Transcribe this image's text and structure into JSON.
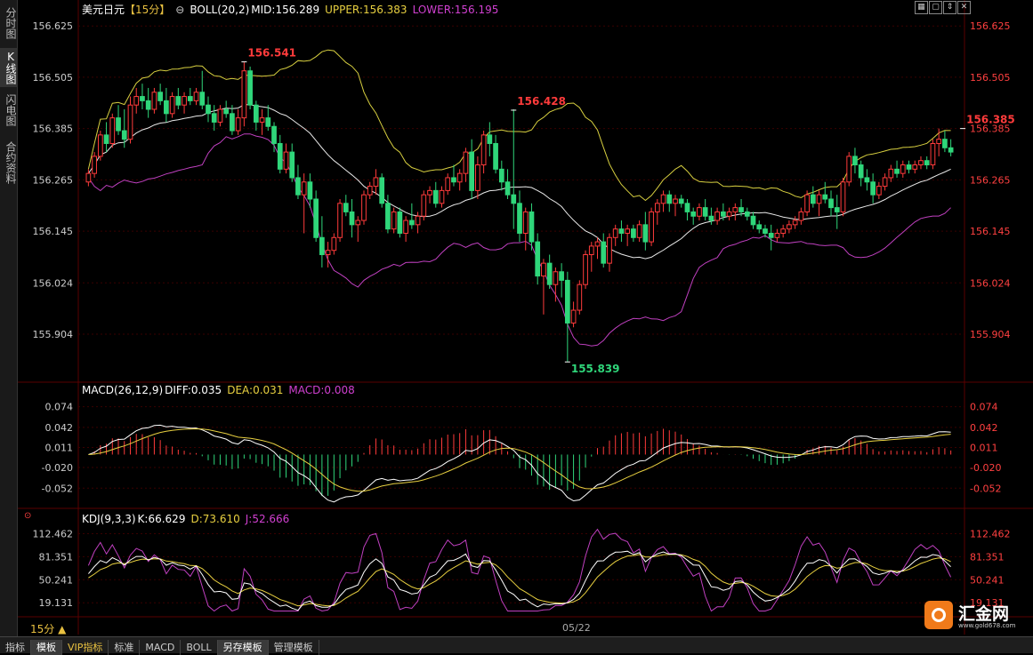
{
  "sidebar": {
    "tabs": [
      "分时图",
      "K线图",
      "闪电图",
      "合约资料"
    ]
  },
  "header": {
    "symbol": "美元日元",
    "period_tag": "【15分】",
    "boll_label": "BOLL(20,2)",
    "mid": "MID:156.289",
    "upper": "UPPER:156.383",
    "lower": "LOWER:156.195"
  },
  "macd_header": {
    "label": "MACD(26,12,9)",
    "diff": "DIFF:0.035",
    "dea": "DEA:0.031",
    "macd": "MACD:0.008"
  },
  "kdj_header": {
    "label": "KDJ(9,3,3)",
    "k": "K:66.629",
    "d": "D:73.610",
    "j": "J:52.666"
  },
  "period_label": "15分 ▲",
  "date_label": "05/22",
  "bottom_tabs": [
    "指标",
    "模板",
    "VIP指标",
    "标准",
    "MACD",
    "BOLL",
    "另存模板",
    "管理模板"
  ],
  "logo": {
    "name": "汇金网",
    "url": "www.gold678.com"
  },
  "colors": {
    "up": "#ff3b3b",
    "down": "#2fd67a",
    "axis_text": "#ff4040",
    "grid": "#3a0000",
    "boll_upper": "#d8d040",
    "boll_mid": "#e8e8e8",
    "boll_lower": "#c040c0",
    "dea": "#e8d040",
    "macd": "#c040c0",
    "kdj_d": "#e8d040",
    "kdj_j": "#c040c0"
  },
  "chart_data": [
    {
      "type": "candlestick",
      "title": "美元日元 15分",
      "y_ticks": [
        156.625,
        156.505,
        156.385,
        156.265,
        156.145,
        156.024,
        155.904
      ],
      "ylim": [
        155.8,
        156.64
      ],
      "annotations": [
        {
          "label": "156.541",
          "value": 156.541,
          "index": 26
        },
        {
          "label": "156.428",
          "value": 156.428,
          "index": 71
        },
        {
          "label": "155.839",
          "value": 155.839,
          "index": 80
        },
        {
          "label": "156.385",
          "value": 156.385,
          "index": 146
        }
      ],
      "candles": [
        [
          156.26,
          156.29,
          156.25,
          156.28
        ],
        [
          156.28,
          156.33,
          156.27,
          156.32
        ],
        [
          156.32,
          156.38,
          156.31,
          156.37
        ],
        [
          156.37,
          156.4,
          156.33,
          156.35
        ],
        [
          156.35,
          156.42,
          156.34,
          156.41
        ],
        [
          156.41,
          156.44,
          156.37,
          156.38
        ],
        [
          156.38,
          156.43,
          156.34,
          156.36
        ],
        [
          156.36,
          156.46,
          156.35,
          156.44
        ],
        [
          156.44,
          156.48,
          156.42,
          156.46
        ],
        [
          156.46,
          156.49,
          156.43,
          156.45
        ],
        [
          156.45,
          156.48,
          156.41,
          156.43
        ],
        [
          156.43,
          156.48,
          156.42,
          156.47
        ],
        [
          156.47,
          156.49,
          156.44,
          156.45
        ],
        [
          156.45,
          156.48,
          156.4,
          156.42
        ],
        [
          156.42,
          156.47,
          156.41,
          156.46
        ],
        [
          156.46,
          156.48,
          156.43,
          156.44
        ],
        [
          156.44,
          156.47,
          156.42,
          156.46
        ],
        [
          156.46,
          156.48,
          156.44,
          156.45
        ],
        [
          156.45,
          156.48,
          156.44,
          156.47
        ],
        [
          156.47,
          156.52,
          156.43,
          156.44
        ],
        [
          156.44,
          156.46,
          156.4,
          156.42
        ],
        [
          156.42,
          156.44,
          156.38,
          156.4
        ],
        [
          156.4,
          156.44,
          156.39,
          156.43
        ],
        [
          156.43,
          156.45,
          156.41,
          156.42
        ],
        [
          156.42,
          156.44,
          156.37,
          156.38
        ],
        [
          156.38,
          156.43,
          156.37,
          156.41
        ],
        [
          156.41,
          156.54,
          156.39,
          156.52
        ],
        [
          156.52,
          156.53,
          156.43,
          156.44
        ],
        [
          156.44,
          156.45,
          156.38,
          156.4
        ],
        [
          156.4,
          156.43,
          156.37,
          156.41
        ],
        [
          156.41,
          156.44,
          156.38,
          156.39
        ],
        [
          156.39,
          156.4,
          156.33,
          156.35
        ],
        [
          156.35,
          156.37,
          156.28,
          156.29
        ],
        [
          156.29,
          156.35,
          156.28,
          156.33
        ],
        [
          156.33,
          156.35,
          156.26,
          156.27
        ],
        [
          156.27,
          156.3,
          156.22,
          156.23
        ],
        [
          156.23,
          156.28,
          156.14,
          156.26
        ],
        [
          156.26,
          156.28,
          156.2,
          156.22
        ],
        [
          156.22,
          156.24,
          156.12,
          156.13
        ],
        [
          156.13,
          156.18,
          156.06,
          156.09
        ],
        [
          156.09,
          156.12,
          156.06,
          156.1
        ],
        [
          156.1,
          156.14,
          156.09,
          156.13
        ],
        [
          156.13,
          156.22,
          156.12,
          156.21
        ],
        [
          156.21,
          156.23,
          156.18,
          156.19
        ],
        [
          156.19,
          156.22,
          156.13,
          156.16
        ],
        [
          156.16,
          156.18,
          156.12,
          156.17
        ],
        [
          156.17,
          156.24,
          156.16,
          156.23
        ],
        [
          156.23,
          156.26,
          156.22,
          156.25
        ],
        [
          156.25,
          156.29,
          156.23,
          156.27
        ],
        [
          156.27,
          156.28,
          156.2,
          156.21
        ],
        [
          156.21,
          156.23,
          156.14,
          156.15
        ],
        [
          156.15,
          156.2,
          156.14,
          156.19
        ],
        [
          156.19,
          156.2,
          156.13,
          156.14
        ],
        [
          156.14,
          156.18,
          156.12,
          156.17
        ],
        [
          156.17,
          156.21,
          156.15,
          156.16
        ],
        [
          156.16,
          156.19,
          156.14,
          156.18
        ],
        [
          156.18,
          156.24,
          156.17,
          156.23
        ],
        [
          156.23,
          156.25,
          156.21,
          156.24
        ],
        [
          156.24,
          156.26,
          156.2,
          156.21
        ],
        [
          156.21,
          156.25,
          156.2,
          156.24
        ],
        [
          156.24,
          156.28,
          156.23,
          156.27
        ],
        [
          156.27,
          156.3,
          156.25,
          156.26
        ],
        [
          156.26,
          156.29,
          156.24,
          156.28
        ],
        [
          156.28,
          156.34,
          156.26,
          156.33
        ],
        [
          156.33,
          156.36,
          156.22,
          156.24
        ],
        [
          156.24,
          156.32,
          156.22,
          156.3
        ],
        [
          156.3,
          156.38,
          156.28,
          156.37
        ],
        [
          156.37,
          156.4,
          156.32,
          156.35
        ],
        [
          156.35,
          156.37,
          156.28,
          156.29
        ],
        [
          156.29,
          156.31,
          156.24,
          156.26
        ],
        [
          156.26,
          156.29,
          156.22,
          156.23
        ],
        [
          156.23,
          156.43,
          156.15,
          156.21
        ],
        [
          156.21,
          156.24,
          156.12,
          156.14
        ],
        [
          156.14,
          156.2,
          156.1,
          156.19
        ],
        [
          156.19,
          156.21,
          156.1,
          156.12
        ],
        [
          156.12,
          156.14,
          156.02,
          156.04
        ],
        [
          156.04,
          156.08,
          155.95,
          156.07
        ],
        [
          156.07,
          156.09,
          156.01,
          156.02
        ],
        [
          156.02,
          156.06,
          155.98,
          156.05
        ],
        [
          156.05,
          156.07,
          155.99,
          156.03
        ],
        [
          156.03,
          156.05,
          155.84,
          155.93
        ],
        [
          155.93,
          155.98,
          155.92,
          155.96
        ],
        [
          155.96,
          156.03,
          155.95,
          156.02
        ],
        [
          156.02,
          156.1,
          156.01,
          156.09
        ],
        [
          156.09,
          156.12,
          156.05,
          156.11
        ],
        [
          156.11,
          156.13,
          156.08,
          156.12
        ],
        [
          156.12,
          156.14,
          156.06,
          156.07
        ],
        [
          156.07,
          156.14,
          156.05,
          156.13
        ],
        [
          156.13,
          156.16,
          156.11,
          156.15
        ],
        [
          156.15,
          156.17,
          156.12,
          156.14
        ],
        [
          156.14,
          156.16,
          156.11,
          156.15
        ],
        [
          156.15,
          156.16,
          156.12,
          156.13
        ],
        [
          156.13,
          156.17,
          156.12,
          156.16
        ],
        [
          156.16,
          156.19,
          156.1,
          156.12
        ],
        [
          156.12,
          156.2,
          156.11,
          156.19
        ],
        [
          156.19,
          156.22,
          156.16,
          156.21
        ],
        [
          156.21,
          156.24,
          156.19,
          156.23
        ],
        [
          156.23,
          156.24,
          156.19,
          156.21
        ],
        [
          156.21,
          156.23,
          156.18,
          156.22
        ],
        [
          156.22,
          156.23,
          156.2,
          156.21
        ],
        [
          156.21,
          156.22,
          156.17,
          156.19
        ],
        [
          156.19,
          156.2,
          156.16,
          156.18
        ],
        [
          156.18,
          156.21,
          156.17,
          156.2
        ],
        [
          156.2,
          156.22,
          156.17,
          156.18
        ],
        [
          156.18,
          156.2,
          156.16,
          156.17
        ],
        [
          156.17,
          156.2,
          156.16,
          156.19
        ],
        [
          156.19,
          156.21,
          156.17,
          156.18
        ],
        [
          156.18,
          156.2,
          156.17,
          156.19
        ],
        [
          156.19,
          156.21,
          156.17,
          156.2
        ],
        [
          156.2,
          156.22,
          156.18,
          156.19
        ],
        [
          156.19,
          156.2,
          156.17,
          156.18
        ],
        [
          156.18,
          156.19,
          156.15,
          156.16
        ],
        [
          156.16,
          156.17,
          156.14,
          156.15
        ],
        [
          156.15,
          156.16,
          156.13,
          156.14
        ],
        [
          156.14,
          156.16,
          156.1,
          156.13
        ],
        [
          156.13,
          156.15,
          156.12,
          156.14
        ],
        [
          156.14,
          156.16,
          156.13,
          156.15
        ],
        [
          156.15,
          156.17,
          156.14,
          156.16
        ],
        [
          156.16,
          156.18,
          156.15,
          156.17
        ],
        [
          156.17,
          156.2,
          156.16,
          156.19
        ],
        [
          156.19,
          156.24,
          156.18,
          156.23
        ],
        [
          156.23,
          156.25,
          156.2,
          156.21
        ],
        [
          156.21,
          156.24,
          156.18,
          156.23
        ],
        [
          156.23,
          156.26,
          156.21,
          156.22
        ],
        [
          156.22,
          156.24,
          156.18,
          156.2
        ],
        [
          156.2,
          156.23,
          156.15,
          156.19
        ],
        [
          156.19,
          156.27,
          156.18,
          156.26
        ],
        [
          156.26,
          156.33,
          156.25,
          156.32
        ],
        [
          156.32,
          156.34,
          156.28,
          156.3
        ],
        [
          156.3,
          156.31,
          156.25,
          156.27
        ],
        [
          156.27,
          156.29,
          156.24,
          156.26
        ],
        [
          156.26,
          156.28,
          156.21,
          156.23
        ],
        [
          156.23,
          156.26,
          156.22,
          156.25
        ],
        [
          156.25,
          156.28,
          156.24,
          156.27
        ],
        [
          156.27,
          156.3,
          156.26,
          156.29
        ],
        [
          156.29,
          156.31,
          156.27,
          156.28
        ],
        [
          156.28,
          156.31,
          156.27,
          156.3
        ],
        [
          156.3,
          156.31,
          156.28,
          156.29
        ],
        [
          156.29,
          156.31,
          156.28,
          156.3
        ],
        [
          156.3,
          156.32,
          156.29,
          156.31
        ],
        [
          156.31,
          156.32,
          156.29,
          156.3
        ],
        [
          156.3,
          156.36,
          156.29,
          156.35
        ],
        [
          156.35,
          156.385,
          156.32,
          156.36
        ],
        [
          156.36,
          156.38,
          156.33,
          156.34
        ],
        [
          156.34,
          156.36,
          156.32,
          156.33
        ]
      ]
    },
    {
      "type": "macd",
      "y_ticks": [
        0.074,
        0.042,
        0.011,
        -0.02,
        -0.052
      ],
      "ylim": [
        -0.075,
        0.09
      ]
    },
    {
      "type": "kdj",
      "y_ticks": [
        112.462,
        81.351,
        50.241,
        19.131
      ],
      "ylim": [
        5,
        125
      ]
    }
  ]
}
